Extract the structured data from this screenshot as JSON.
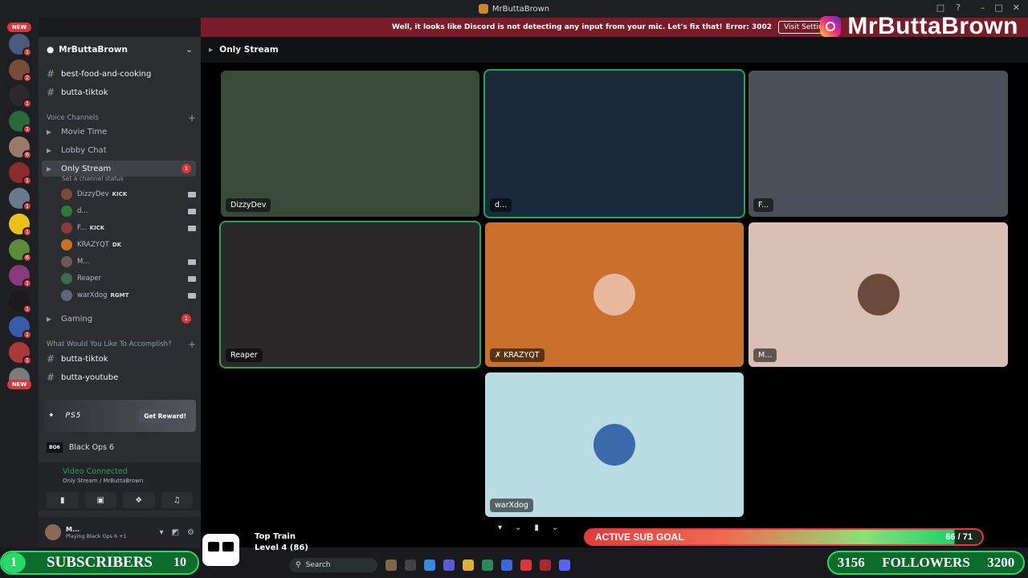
{
  "window": {
    "title": "MrButtaBrown"
  },
  "notice": {
    "message": "Well, it looks like Discord is not detecting any input from your mic. Let's fix that!",
    "error": "Error: 3002",
    "button": "Visit Settings"
  },
  "brand": {
    "name": "MrButtaBrown"
  },
  "rail": {
    "new_label": "NEW"
  },
  "server": {
    "name": "MrButtaBrown"
  },
  "channels": {
    "text_top": [
      "best-food-and-cooking",
      "butta-tiktok"
    ],
    "voice_category": "Voice Channels",
    "voice": [
      "Movie Time",
      "Lobby Chat"
    ],
    "active": "Only Stream",
    "active_badge": "1",
    "status_hint": "Set a channel status",
    "gaming": "Gaming",
    "gaming_badge": "1",
    "category2": "What Would You Like To Accomplish?",
    "text_bottom": [
      "butta-tiktok",
      "butta-youtube"
    ]
  },
  "voice_users": [
    {
      "name": "DizzyDev",
      "tag": "KICK",
      "color": "#7b4a3a"
    },
    {
      "name": "d...",
      "tag": "",
      "color": "#2f7a3a"
    },
    {
      "name": "F...",
      "tag": "KICK",
      "color": "#8a3a3a"
    },
    {
      "name": "KRAZYQT",
      "tag": "DK",
      "color": "#c9712c"
    },
    {
      "name": "M...",
      "tag": "",
      "color": "#6a5a55"
    },
    {
      "name": "Reaper",
      "tag": "",
      "color": "#3e6a4a"
    },
    {
      "name": "warXdog",
      "tag": "RGMT",
      "color": "#5a6a7a"
    }
  ],
  "promo": {
    "platform": "PS5",
    "button": "Get Reward!"
  },
  "activity": {
    "game": "Black Ops 6",
    "logo": "BO6"
  },
  "voice_status": {
    "title": "Video Connected",
    "location": "Only Stream / MrButtaBrown"
  },
  "user": {
    "name": "M...",
    "activity": "Playing Black Ops 6 +1"
  },
  "main": {
    "channel": "Only Stream"
  },
  "tiles": [
    {
      "name": "DizzyDev",
      "speaking": false,
      "bg": "#3a4a3a"
    },
    {
      "name": "d...",
      "speaking": true,
      "bg": "#1a2a3a"
    },
    {
      "name": "F...",
      "speaking": false,
      "bg": "#4a4f58"
    },
    {
      "name": "Reaper",
      "speaking": true,
      "bg": "#2a2828"
    },
    {
      "name": "KRAZYQT",
      "speaking": false,
      "bg": "#c9712c"
    },
    {
      "name": "M...",
      "speaking": false,
      "bg": "#d9bfb4"
    },
    {
      "name": "warXdog",
      "speaking": false,
      "bg": "#b9dbe2"
    }
  ],
  "overlays": {
    "subscribers": {
      "current": "1",
      "label": "SUBSCRIBERS",
      "goal": "10"
    },
    "train": {
      "title": "Top Train",
      "level": "Level 4 (86)"
    },
    "sub_goal": {
      "label": "ACTIVE SUB GOAL",
      "count": "66 / 71",
      "progress": 0.93
    },
    "followers": {
      "current": "3156",
      "label": "FOLLOWERS",
      "goal": "3200"
    }
  },
  "taskbar": {
    "search_placeholder": "Search"
  },
  "colors": {
    "accent_red": "#da373c",
    "online_green": "#23a55a",
    "notice_bg": "#7a1b2a"
  }
}
